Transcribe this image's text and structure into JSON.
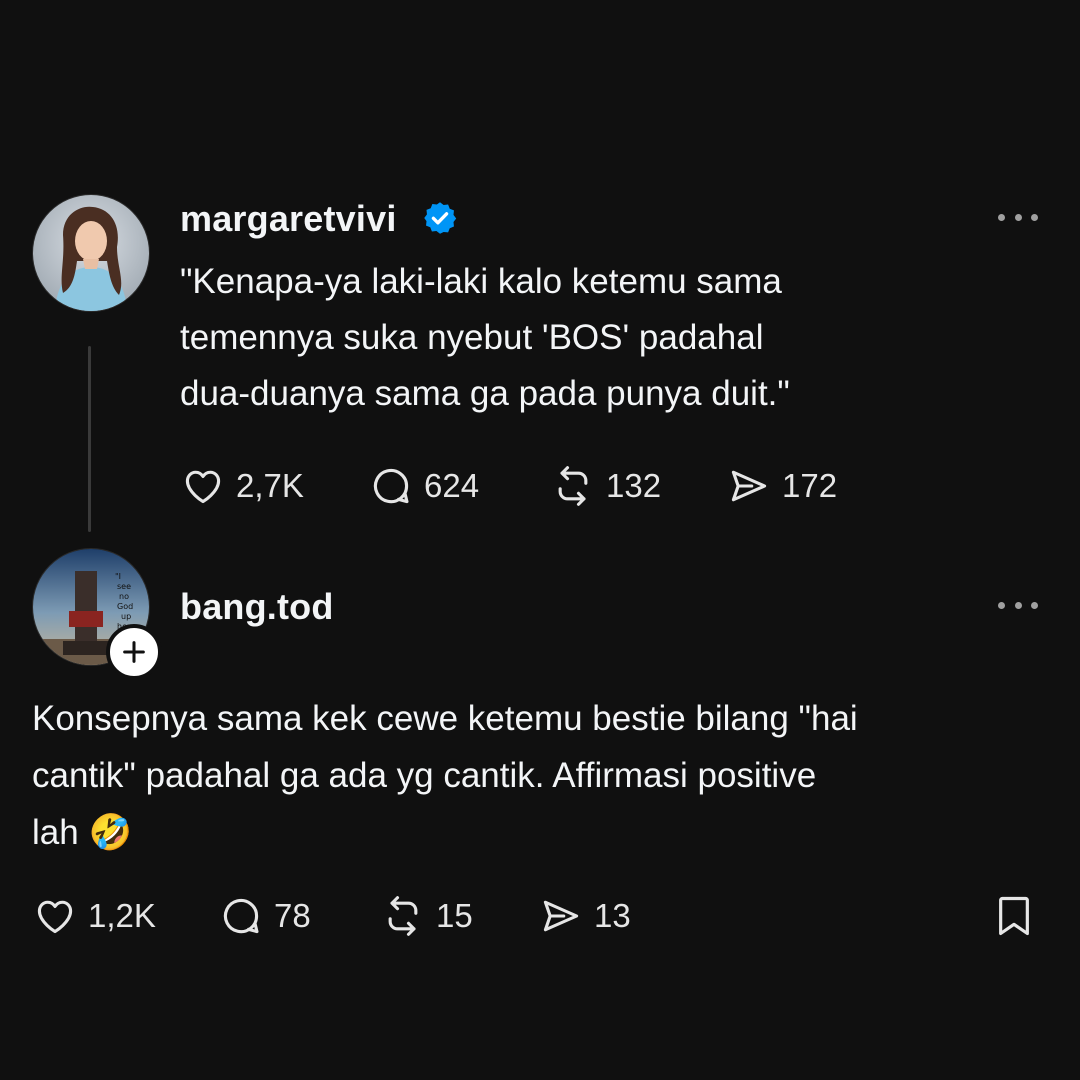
{
  "post": {
    "username": "margaretvivi",
    "verified": true,
    "text_lines": [
      "\"Kenapa-ya laki-laki kalo ketemu sama",
      "temennya suka nyebut 'BOS' padahal",
      "dua-duanya sama ga pada punya duit.\""
    ],
    "likes": "2,7K",
    "replies": "624",
    "reposts": "132",
    "shares": "172"
  },
  "reply": {
    "username": "bang.tod",
    "avatar_caption": [
      "\"I",
      "see",
      "no",
      "God",
      "up",
      "here"
    ],
    "text_lines": [
      "Konsepnya sama kek cewe ketemu bestie bilang \"hai",
      "cantik\" padahal ga ada yg cantik. Affirmasi positive",
      "lah "
    ],
    "emoji": "🤣",
    "likes": "1,2K",
    "replies": "78",
    "reposts": "15",
    "shares": "13"
  },
  "icons": {
    "like": "heart-icon",
    "reply": "comment-icon",
    "repost": "repost-icon",
    "share": "share-icon",
    "bookmark": "bookmark-icon",
    "more": "more-icon",
    "verified": "verified-badge-icon",
    "follow": "plus-icon"
  },
  "colors": {
    "background": "#101010",
    "text": "#f3f5f7",
    "verified": "#0095f6",
    "muted": "#a0a0a0"
  }
}
